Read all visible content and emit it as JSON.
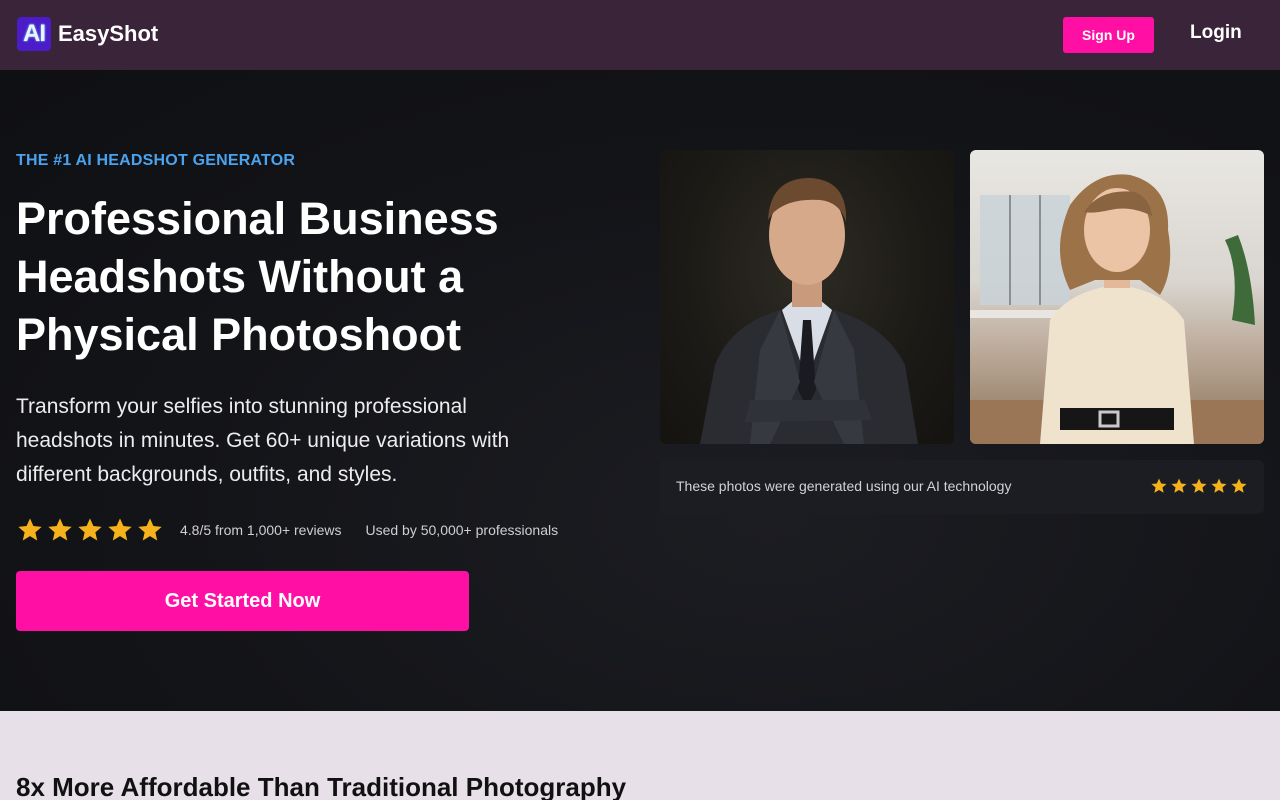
{
  "header": {
    "logo_mark": "AI",
    "brand": "EasyShot",
    "signup_label": "Sign Up",
    "login_label": "Login"
  },
  "hero": {
    "eyebrow": "THE #1 AI HEADSHOT GENERATOR",
    "headline": "Professional Business Headshots Without a Physical Photoshoot",
    "subtext": "Transform your selfies into stunning professional headshots in minutes. Get 60+ unique variations with different backgrounds, outfits, and styles.",
    "rating_stars": 5,
    "rating_text": "4.8/5 from 1,000+ reviews",
    "used_text": "Used by 50,000+ professionals",
    "cta_label": "Get Started Now"
  },
  "gallery": {
    "caption": "These photos were generated using our AI technology",
    "caption_stars": 5
  },
  "section2": {
    "title": "8x More Affordable Than Traditional Photography"
  },
  "colors": {
    "header_bg": "#3a2439",
    "accent_pink": "#ff0fa3",
    "eyebrow_blue": "#4aa3ef",
    "star_gold": "#f5b21c",
    "section2_bg": "#e8e0e9"
  },
  "icons": {
    "star": "star-icon",
    "logo": "ai-logo-icon"
  }
}
